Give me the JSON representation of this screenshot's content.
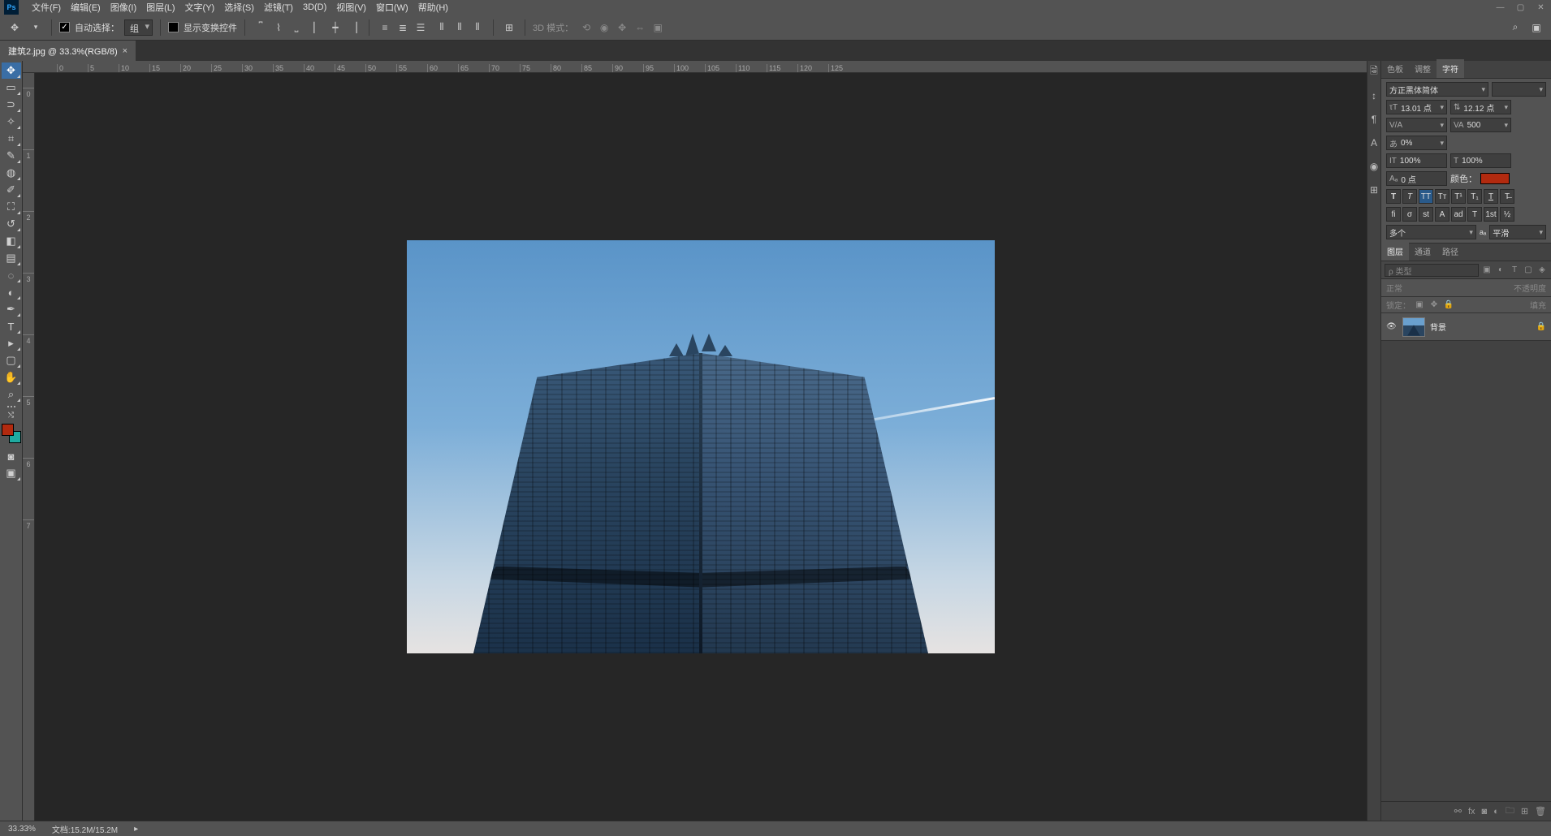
{
  "menu": [
    "文件(F)",
    "编辑(E)",
    "图像(I)",
    "图层(L)",
    "文字(Y)",
    "选择(S)",
    "滤镜(T)",
    "3D(D)",
    "视图(V)",
    "窗口(W)",
    "帮助(H)"
  ],
  "options": {
    "autoSelectLabel": "自动选择：",
    "autoSelectValue": "组",
    "showTransformLabel": "显示变换控件",
    "mode3d": "3D 模式："
  },
  "docTab": "建筑2.jpg @ 33.3%(RGB/8)",
  "rulerTop": [
    "0",
    "5",
    "10",
    "15",
    "20",
    "25",
    "30",
    "35",
    "40",
    "45",
    "50",
    "55",
    "60",
    "65",
    "70",
    "75",
    "80",
    "85",
    "90",
    "95",
    "100",
    "105",
    "110",
    "115",
    "120",
    "125"
  ],
  "rulerLeft": [
    "0",
    "1",
    "2",
    "3",
    "4",
    "5",
    "6",
    "7"
  ],
  "panels": {
    "topTabs": [
      "色板",
      "调整",
      "字符"
    ],
    "char": {
      "font": "方正黑体简体",
      "size": "13.01 点",
      "leading": "12.12 点",
      "kerning": "",
      "tracking": "500",
      "scale": "0%",
      "vscale": "100%",
      "hscale": "100%",
      "baseline": "0 点",
      "colorLabel": "颜色：",
      "color": "#b22a0f",
      "lang": "多个",
      "aa": "平滑"
    },
    "layerTabs": [
      "图层",
      "通道",
      "路径"
    ],
    "searchPlaceholder": "ρ 类型",
    "blendMode": "正常",
    "opacityLabel": "不透明度",
    "lockLabel": "锁定：",
    "fillLabel": "填充",
    "layer": {
      "name": "背景"
    }
  },
  "status": {
    "zoom": "33.33%",
    "doc": "文档:15.2M/15.2M"
  }
}
